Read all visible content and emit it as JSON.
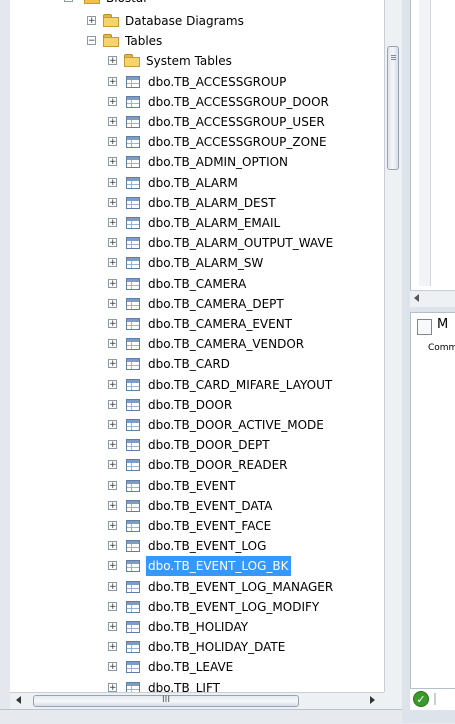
{
  "tree": {
    "partial_db_label": "Biostar",
    "items": [
      {
        "label": "Database Diagrams",
        "icon": "folder-icon",
        "expander": "+",
        "level": 1
      },
      {
        "label": "Tables",
        "icon": "folder-icon",
        "expander": "−",
        "level": 1
      },
      {
        "label": "System Tables",
        "icon": "folder-icon",
        "expander": "+",
        "level": 2
      },
      {
        "label": "dbo.TB_ACCESSGROUP",
        "icon": "table-icon",
        "expander": "+",
        "level": 2
      },
      {
        "label": "dbo.TB_ACCESSGROUP_DOOR",
        "icon": "table-icon",
        "expander": "+",
        "level": 2
      },
      {
        "label": "dbo.TB_ACCESSGROUP_USER",
        "icon": "table-icon",
        "expander": "+",
        "level": 2
      },
      {
        "label": "dbo.TB_ACCESSGROUP_ZONE",
        "icon": "table-icon",
        "expander": "+",
        "level": 2
      },
      {
        "label": "dbo.TB_ADMIN_OPTION",
        "icon": "table-icon",
        "expander": "+",
        "level": 2
      },
      {
        "label": "dbo.TB_ALARM",
        "icon": "table-icon",
        "expander": "+",
        "level": 2
      },
      {
        "label": "dbo.TB_ALARM_DEST",
        "icon": "table-icon",
        "expander": "+",
        "level": 2
      },
      {
        "label": "dbo.TB_ALARM_EMAIL",
        "icon": "table-icon",
        "expander": "+",
        "level": 2
      },
      {
        "label": "dbo.TB_ALARM_OUTPUT_WAVE",
        "icon": "table-icon",
        "expander": "+",
        "level": 2
      },
      {
        "label": "dbo.TB_ALARM_SW",
        "icon": "table-icon",
        "expander": "+",
        "level": 2
      },
      {
        "label": "dbo.TB_CAMERA",
        "icon": "table-icon",
        "expander": "+",
        "level": 2
      },
      {
        "label": "dbo.TB_CAMERA_DEPT",
        "icon": "table-icon",
        "expander": "+",
        "level": 2
      },
      {
        "label": "dbo.TB_CAMERA_EVENT",
        "icon": "table-icon",
        "expander": "+",
        "level": 2
      },
      {
        "label": "dbo.TB_CAMERA_VENDOR",
        "icon": "table-icon",
        "expander": "+",
        "level": 2
      },
      {
        "label": "dbo.TB_CARD",
        "icon": "table-icon",
        "expander": "+",
        "level": 2
      },
      {
        "label": "dbo.TB_CARD_MIFARE_LAYOUT",
        "icon": "table-icon",
        "expander": "+",
        "level": 2
      },
      {
        "label": "dbo.TB_DOOR",
        "icon": "table-icon",
        "expander": "+",
        "level": 2
      },
      {
        "label": "dbo.TB_DOOR_ACTIVE_MODE",
        "icon": "table-icon",
        "expander": "+",
        "level": 2
      },
      {
        "label": "dbo.TB_DOOR_DEPT",
        "icon": "table-icon",
        "expander": "+",
        "level": 2
      },
      {
        "label": "dbo.TB_DOOR_READER",
        "icon": "table-icon",
        "expander": "+",
        "level": 2
      },
      {
        "label": "dbo.TB_EVENT",
        "icon": "table-icon",
        "expander": "+",
        "level": 2
      },
      {
        "label": "dbo.TB_EVENT_DATA",
        "icon": "table-icon",
        "expander": "+",
        "level": 2
      },
      {
        "label": "dbo.TB_EVENT_FACE",
        "icon": "table-icon",
        "expander": "+",
        "level": 2
      },
      {
        "label": "dbo.TB_EVENT_LOG",
        "icon": "table-icon",
        "expander": "+",
        "level": 2
      },
      {
        "label": "dbo.TB_EVENT_LOG_BK",
        "icon": "table-icon",
        "expander": "+",
        "level": 2,
        "selected": true
      },
      {
        "label": "dbo.TB_EVENT_LOG_MANAGER",
        "icon": "table-icon",
        "expander": "+",
        "level": 2
      },
      {
        "label": "dbo.TB_EVENT_LOG_MODIFY",
        "icon": "table-icon",
        "expander": "+",
        "level": 2
      },
      {
        "label": "dbo.TB_HOLIDAY",
        "icon": "table-icon",
        "expander": "+",
        "level": 2
      },
      {
        "label": "dbo.TB_HOLIDAY_DATE",
        "icon": "table-icon",
        "expander": "+",
        "level": 2
      },
      {
        "label": "dbo.TB_LEAVE",
        "icon": "table-icon",
        "expander": "+",
        "level": 2
      },
      {
        "label": "dbo.TB_LIFT",
        "icon": "table-icon",
        "expander": "+",
        "level": 2
      }
    ]
  },
  "hscroll": {
    "thumb_grip": "III"
  },
  "right_pane": {
    "heading_partial": "M",
    "comment_partial": "Comm",
    "status_icon": "check-icon"
  },
  "colors": {
    "selection": "#3399ff",
    "folder": "#f7d36b",
    "status_ok": "#3a9a2a"
  }
}
